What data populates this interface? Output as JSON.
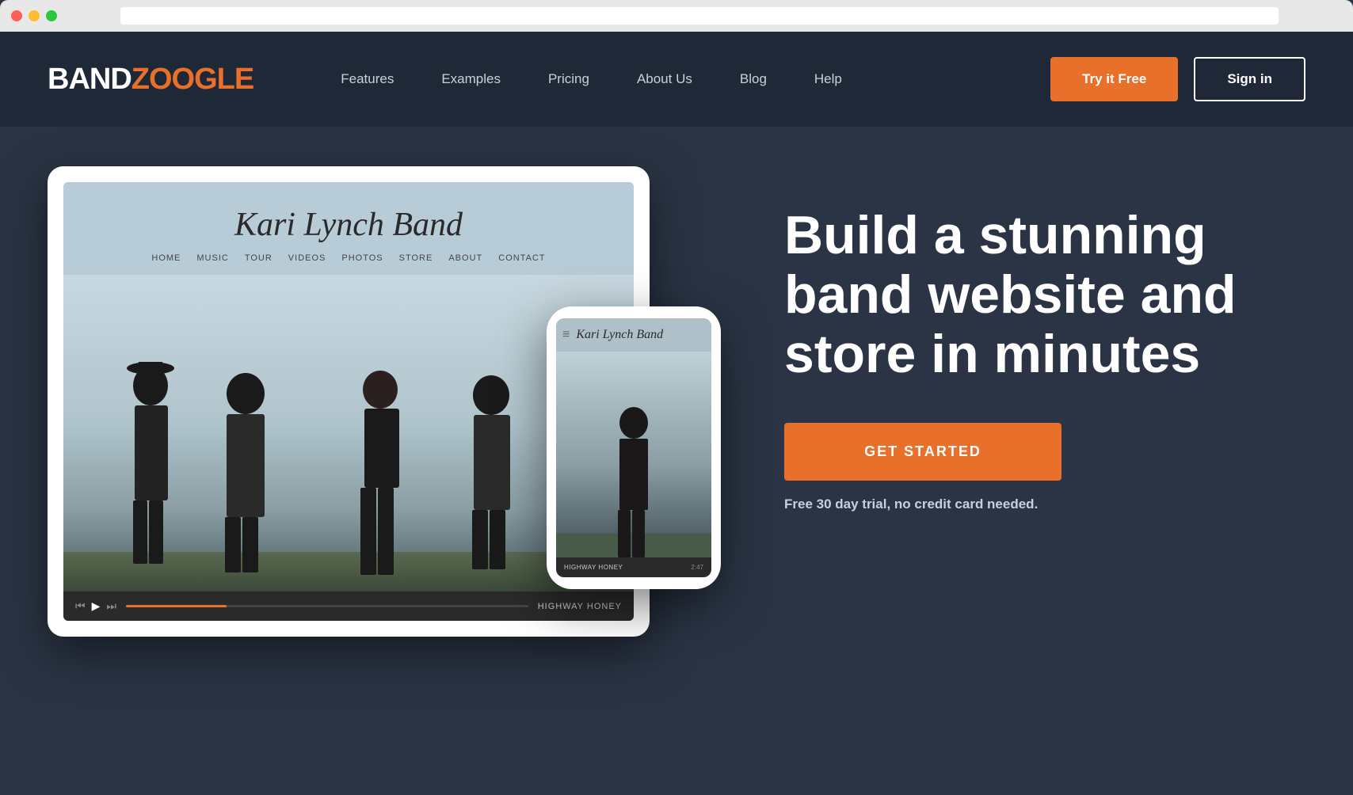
{
  "window": {
    "address_bar": ""
  },
  "logo": {
    "band_text": "BAND",
    "zoogle_text": "ZOOGLE"
  },
  "nav": {
    "items": [
      {
        "label": "Features",
        "id": "features"
      },
      {
        "label": "Examples",
        "id": "examples"
      },
      {
        "label": "Pricing",
        "id": "pricing"
      },
      {
        "label": "About Us",
        "id": "about"
      },
      {
        "label": "Blog",
        "id": "blog"
      },
      {
        "label": "Help",
        "id": "help"
      }
    ]
  },
  "header": {
    "try_free_label": "Try it Free",
    "sign_in_label": "Sign in"
  },
  "hero": {
    "headline": "Build a stunning band website and store in minutes",
    "cta_button": "GET STARTED",
    "sub_text": "Free 30 day trial, no credit card needed."
  },
  "tablet_site": {
    "title": "Kari Lynch Band",
    "nav_items": [
      "HOME",
      "MUSIC",
      "TOUR",
      "VIDEOS",
      "PHOTOS",
      "STORE",
      "ABOUT",
      "CONTACT"
    ],
    "player_track": "HIGHWAY HONEY"
  },
  "phone_site": {
    "title": "Kari Lynch Band",
    "player_track": "HIGHWAY HONEY",
    "player_time": "2:47"
  },
  "colors": {
    "orange": "#e8702a",
    "dark_bg": "#2a3444",
    "header_bg": "#1e2835",
    "text_light": "#c8d0db",
    "white": "#ffffff"
  }
}
